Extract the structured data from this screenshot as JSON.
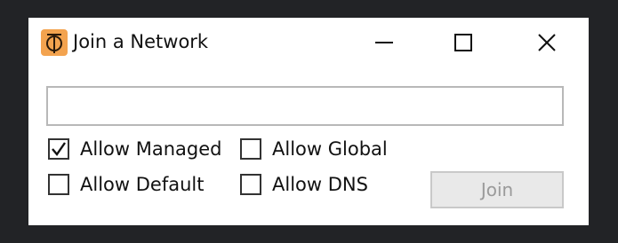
{
  "window": {
    "title": "Join a Network",
    "icon": "zerotier-logo-icon",
    "accent_color": "#f3a34f",
    "controls": [
      "minimize-icon",
      "maximize-icon",
      "close-icon"
    ]
  },
  "network_input": {
    "value": "",
    "placeholder": ""
  },
  "options": [
    {
      "label": "Allow Managed",
      "checked": true
    },
    {
      "label": "Allow Global",
      "checked": false
    },
    {
      "label": "Allow Default",
      "checked": false
    },
    {
      "label": "Allow DNS",
      "checked": false
    }
  ],
  "join_button": {
    "label": "Join",
    "enabled": false
  }
}
